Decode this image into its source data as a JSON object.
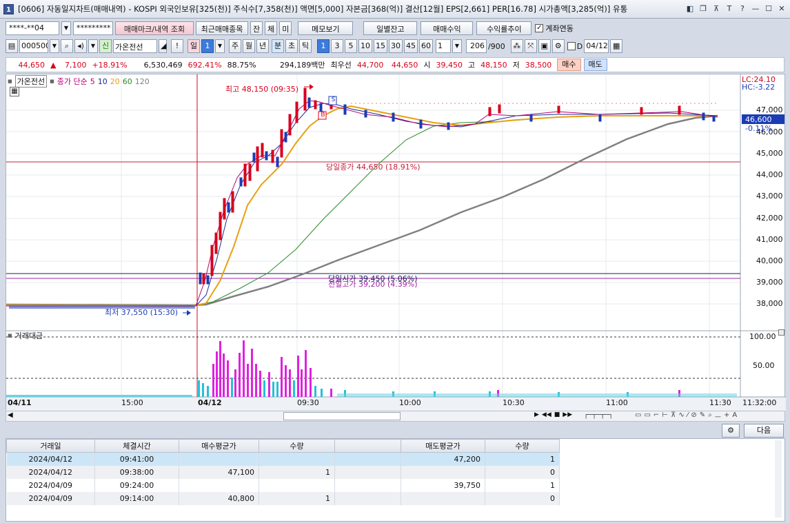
{
  "window": {
    "num": "1",
    "title": "[0606] 자동일지차트(매매내역) - KOSPI 외국인보유[325(천)] 주식수[7,358(천)] 액면[5,000] 자본금[368(억)] 결산[12월] EPS[2,661] PER[16.78] 시가총액[3,285(억)] 유통"
  },
  "toolbar1": {
    "account": "****-**04",
    "password": "*********",
    "btn_trade_mark": "매매마크/내역 조회",
    "btn_recent": "최근매매종목",
    "btn_jan": "잔",
    "btn_che": "체",
    "btn_mi": "미",
    "btn_memo": "메모보기",
    "btn_daily_balance": "일별잔고",
    "btn_profit": "매매수익",
    "btn_return": "수익률추이",
    "chk_link_label": "계좌연동"
  },
  "toolbar2": {
    "code": "000500",
    "badge": "신",
    "name": "가온전선",
    "excl": "!",
    "period_day": "일",
    "period_day_num": "1",
    "periods": [
      "주",
      "월",
      "년"
    ],
    "min_sel": "분",
    "periods2": [
      "초",
      "틱"
    ],
    "intervals": [
      "1",
      "3",
      "5",
      "10",
      "15",
      "30",
      "45",
      "60"
    ],
    "interval_input": "1",
    "count": "206",
    "count_max": "/900",
    "chk_d": "D",
    "date": "04/12"
  },
  "quote": {
    "price": "44,650",
    "arrow": "▲",
    "change": "7,100",
    "change_pct": "+18.91%",
    "volume": "6,530,469",
    "vol_ratio": "692.41%",
    "percent2": "88.75%",
    "amount": "294,189백만",
    "best_label": "최우선",
    "best_ask": "44,700",
    "best_bid": "44,650",
    "open_label": "시",
    "open": "39,450",
    "high_label": "고",
    "high": "48,150",
    "low_label": "저",
    "low": "38,500",
    "buy": "매수",
    "sell": "매도"
  },
  "chart": {
    "stock_label": "가온전선",
    "ma_title": "종가 단순",
    "ma_periods": [
      "5",
      "10",
      "20",
      "60",
      "120"
    ],
    "lc": "LC:24.10",
    "hc": "HC:-3.22",
    "high_label": "최고 48,150 (09:35)",
    "low_label": "최저 37,550 (15:30)",
    "close_label": "당일종가 44,650 (18.91%)",
    "open_label": "당일시가 39,450 (5.06%)",
    "prev_high_label": "전일고가 39,200 (4.39%)",
    "marker_s": "S",
    "marker_b": "B",
    "price_axis": [
      "47,000",
      "46,000",
      "45,000",
      "44,000",
      "43,000",
      "42,000",
      "41,000",
      "40,000",
      "39,000",
      "38,000"
    ],
    "cur_price": "46,600",
    "cur_pct": "-0.11%",
    "volume_title": "거래대금",
    "vol_axis": [
      "100.00",
      "50.00"
    ],
    "time_axis": [
      "04/11",
      "15:00",
      "04/12",
      "09:30",
      "10:00",
      "10:30",
      "11:00",
      "11:30",
      "11:32:00"
    ]
  },
  "nav": {
    "btns": [
      "▶",
      "◀◀",
      "■",
      "▶▶",
      "ㅡ",
      "+",
      "A"
    ]
  },
  "bottom": {
    "next": "다음"
  },
  "table": {
    "headers": [
      "거래일",
      "체결시간",
      "매수평균가",
      "수량",
      "",
      "매도평균가",
      "수량"
    ],
    "rows": [
      [
        "2024/04/12",
        "09:41:00",
        "",
        "",
        "",
        "47,200",
        "1"
      ],
      [
        "2024/04/12",
        "09:38:00",
        "47,100",
        "1",
        "",
        "",
        "0"
      ],
      [
        "2024/04/09",
        "09:24:00",
        "",
        "",
        "",
        "39,750",
        "1"
      ],
      [
        "2024/04/09",
        "09:14:00",
        "40,800",
        "1",
        "",
        "",
        "0"
      ]
    ]
  }
}
